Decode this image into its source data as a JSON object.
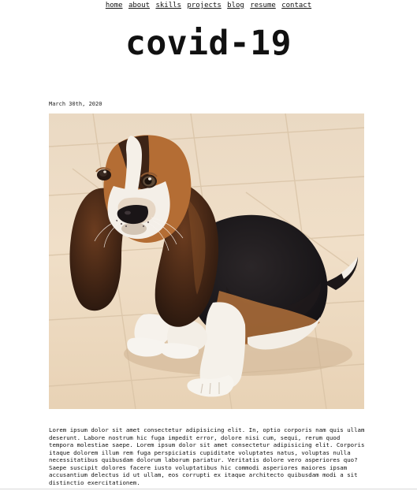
{
  "nav": {
    "items": [
      "home",
      "about",
      "skills",
      "projects",
      "blog",
      "resume",
      "contact"
    ]
  },
  "post": {
    "title": "covid-19",
    "date": "March 30th, 2020",
    "image_icon": "basset-hound-puppy-photo",
    "body": "Lorem ipsum dolor sit amet consectetur adipisicing elit. In, optio corporis nam quis ullam deserunt. Labore nostrum hic fuga impedit error, dolore nisi cum, sequi, rerum quod tempora molestiae saepe. Lorem ipsum dolor sit amet consectetur adipisicing elit. Corporis itaque dolorem illum rem fuga perspiciatis cupiditate voluptates natus, voluptas nulla necessitatibus quibusdam dolorum laborum pariatur. Veritatis dolore vero asperiores quo? Saepe suscipit dolores facere iusto voluptatibus hic commodi asperiores maiores ipsam accusantium delectus id ut ullam, eos corrupti ex itaque architecto quibusdam modi a sit distinctio exercitationem."
  }
}
